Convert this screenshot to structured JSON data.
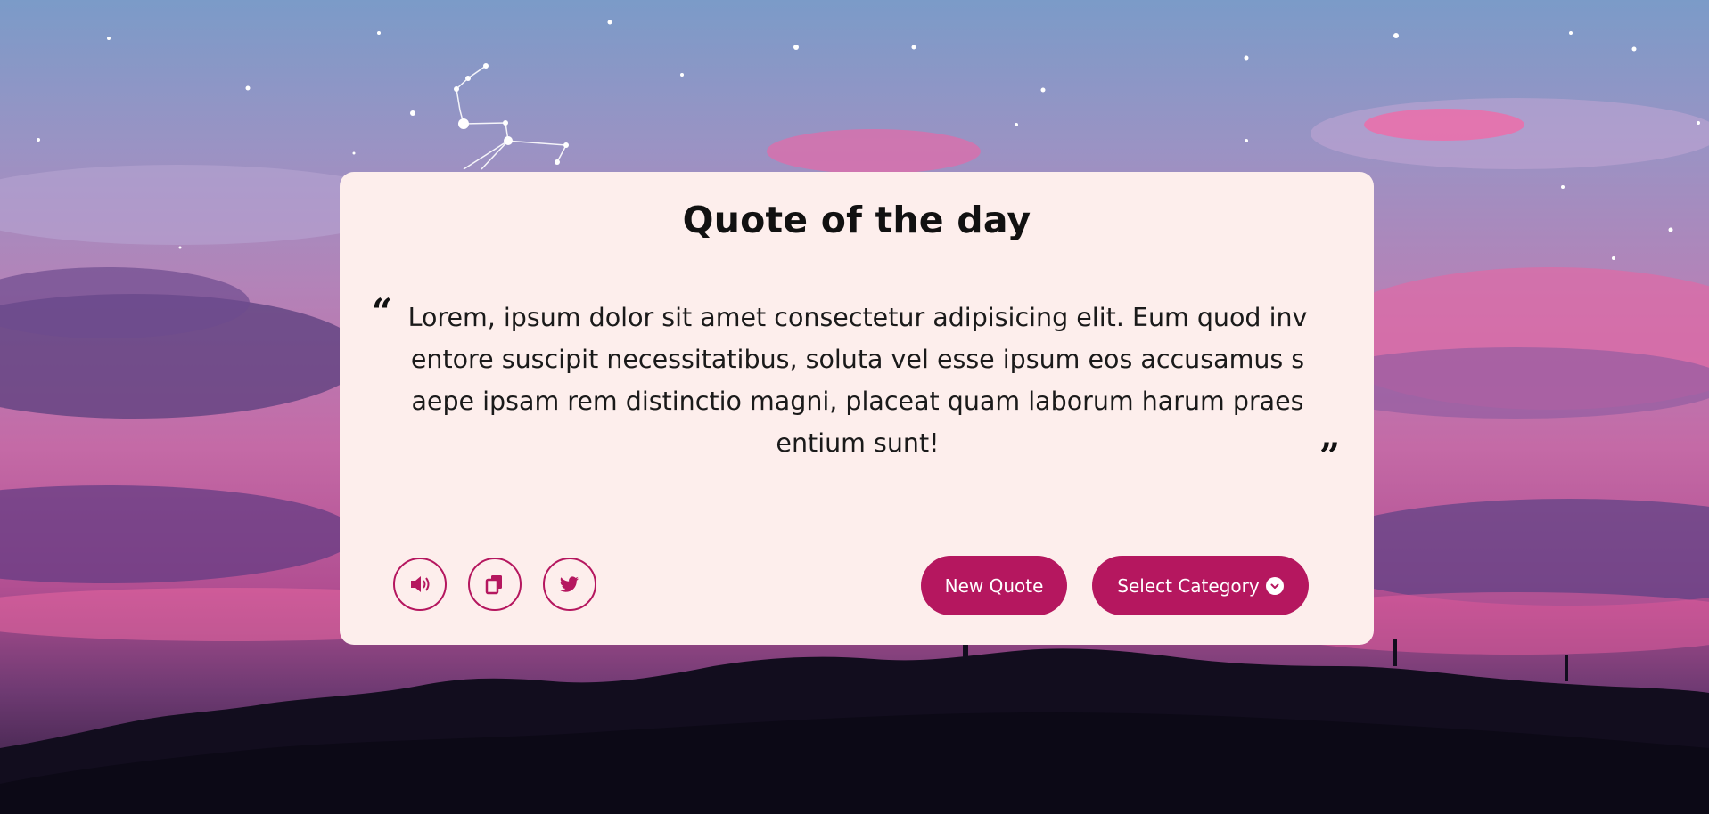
{
  "card": {
    "title": "Quote of the day",
    "quote_text": "Lorem, ipsum dolor sit amet consectetur adipisicing elit. Eum quod inventore suscipit necessitatibus, soluta vel esse ipsum eos accusamus saepe ipsam rem distinctio magni, placeat quam laborum harum praesentium sunt!",
    "quote_open_mark": "“",
    "quote_close_mark": "”"
  },
  "actions": {
    "speak_icon": "volume-icon",
    "copy_icon": "copy-icon",
    "twitter_icon": "twitter-icon",
    "new_quote_label": "New Quote",
    "category_label": "Select Category",
    "category_icon": "chevron-down-circle-icon"
  },
  "colors": {
    "accent": "#b5175f",
    "card_background": "#fdeeec"
  }
}
